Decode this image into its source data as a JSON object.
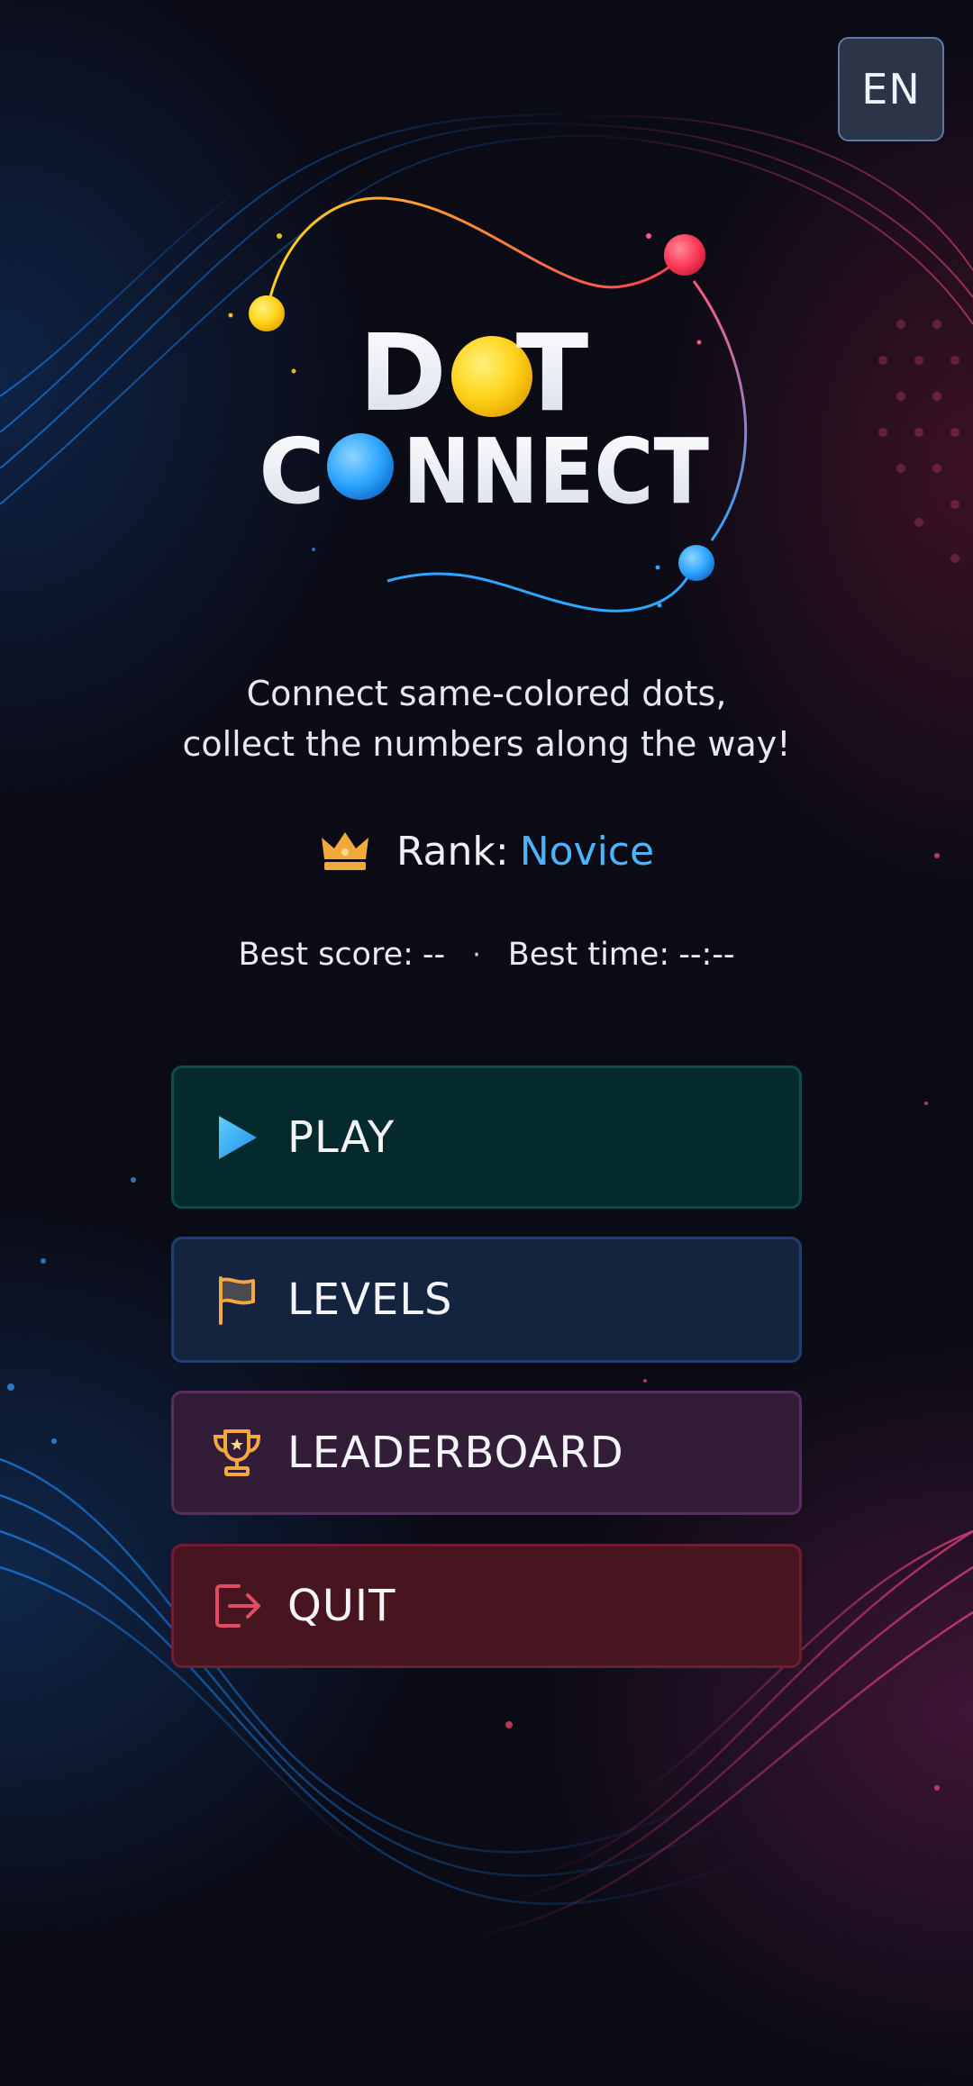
{
  "language": {
    "code": "EN"
  },
  "logo": {
    "line1": [
      "D",
      "O",
      "T"
    ],
    "line2": [
      "C",
      "O",
      "NNECT"
    ]
  },
  "tagline": {
    "line1": "Connect same-colored dots,",
    "line2": "collect the numbers along the way!"
  },
  "rank": {
    "label": "Rank:",
    "value": "Novice",
    "icon": "crown-icon"
  },
  "stats": {
    "best_score_label": "Best score:",
    "best_score_value": "--",
    "separator": "·",
    "best_time_label": "Best time:",
    "best_time_value": "--:--"
  },
  "menu": [
    {
      "id": "play",
      "label": "PLAY",
      "icon": "play-icon"
    },
    {
      "id": "levels",
      "label": "LEVELS",
      "icon": "flag-icon"
    },
    {
      "id": "leaderboard",
      "label": "LEADERBOARD",
      "icon": "trophy-icon"
    },
    {
      "id": "quit",
      "label": "QUIT",
      "icon": "exit-icon"
    }
  ],
  "colors": {
    "yellow_dot": "#ffd21a",
    "red_dot": "#ff3b57",
    "blue_dot": "#2ea6ff",
    "rank_value": "#4db3ff",
    "icon_gold": "#f2a93b",
    "icon_red": "#e04c62"
  }
}
